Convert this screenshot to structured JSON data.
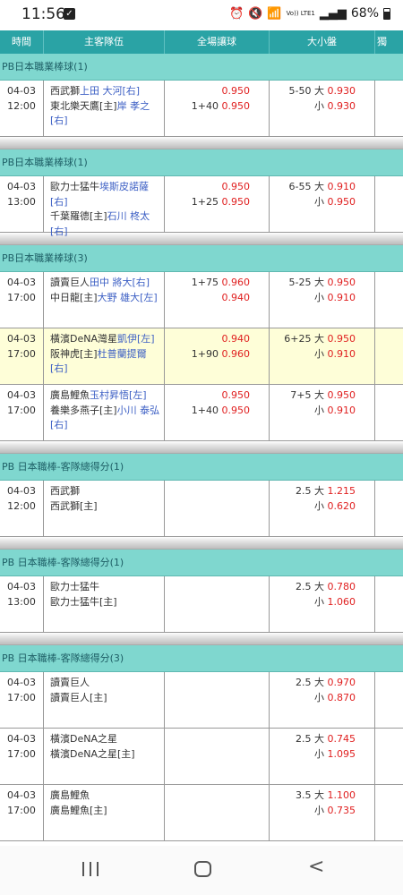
{
  "status_bar": {
    "time": "11:56",
    "battery": "68%",
    "volte": "Vo)) LTE1"
  },
  "header": {
    "time": "時間",
    "teams": "主客隊伍",
    "handicap": "全場讓球",
    "over_under": "大小盤",
    "extra": "獨"
  },
  "sections": [
    {
      "league": "PB日本職業棒球(1)",
      "matches": [
        {
          "date": "04-03",
          "time": "12:00",
          "highlight": false,
          "team1": "西武獅",
          "p1": "上田 大河[右]",
          "team2": "東北樂天鷹[主]",
          "p2": "岸 孝之[右]",
          "hdp_line1": "",
          "hdp_odds1": "0.950",
          "hdp_line2": "1+40",
          "hdp_odds2": "0.950",
          "ou_line1": "5-50 大",
          "ou_odds1": "0.930",
          "ou_line2": "小",
          "ou_odds2": "0.930"
        }
      ]
    },
    {
      "league": "PB日本職業棒球(1)",
      "matches": [
        {
          "date": "04-03",
          "time": "13:00",
          "highlight": false,
          "team1": "歐力士猛牛",
          "p1": "埃斯皮諾薩[右]",
          "team2": "千葉羅德[主]",
          "p2": "石川 柊太[右]",
          "hdp_line1": "",
          "hdp_odds1": "0.950",
          "hdp_line2": "1+25",
          "hdp_odds2": "0.950",
          "ou_line1": "6-55 大",
          "ou_odds1": "0.910",
          "ou_line2": "小",
          "ou_odds2": "0.950"
        }
      ]
    },
    {
      "league": "PB日本職業棒球(3)",
      "matches": [
        {
          "date": "04-03",
          "time": "17:00",
          "highlight": false,
          "team1": "讀賣巨人",
          "p1": "田中 將大[右]",
          "team2": "中日龍[主]",
          "p2": "大野 雄大[左]",
          "hdp_line1": "1+75",
          "hdp_odds1": "0.960",
          "hdp_line2": "",
          "hdp_odds2": "0.940",
          "ou_line1": "5-25 大",
          "ou_odds1": "0.950",
          "ou_line2": "小",
          "ou_odds2": "0.910"
        },
        {
          "date": "04-03",
          "time": "17:00",
          "highlight": true,
          "team1": "橫濱DeNA灣星",
          "p1": "凱伊[左]",
          "team2": "阪神虎[主]",
          "p2": "杜普蘭提爾[右]",
          "hdp_line1": "",
          "hdp_odds1": "0.940",
          "hdp_line2": "1+90",
          "hdp_odds2": "0.960",
          "ou_line1": "6+25 大",
          "ou_odds1": "0.950",
          "ou_line2": "小",
          "ou_odds2": "0.910"
        },
        {
          "date": "04-03",
          "time": "17:00",
          "highlight": false,
          "team1": "廣島鯉魚",
          "p1": "玉村昇悟[左]",
          "team2": "養樂多燕子[主]",
          "p2": "小川 泰弘[右]",
          "hdp_line1": "",
          "hdp_odds1": "0.950",
          "hdp_line2": "1+40",
          "hdp_odds2": "0.950",
          "ou_line1": "7+5 大",
          "ou_odds1": "0.950",
          "ou_line2": "小",
          "ou_odds2": "0.910"
        }
      ]
    },
    {
      "league": "PB 日本職棒-客隊總得分(1)",
      "matches": [
        {
          "date": "04-03",
          "time": "12:00",
          "highlight": false,
          "team1": "西武獅",
          "p1": "",
          "team2": "西武獅[主]",
          "p2": "",
          "hdp_line1": "",
          "hdp_odds1": "",
          "hdp_line2": "",
          "hdp_odds2": "",
          "ou_line1": "2.5 大",
          "ou_odds1": "1.215",
          "ou_line2": "小",
          "ou_odds2": "0.620"
        }
      ]
    },
    {
      "league": "PB 日本職棒-客隊總得分(1)",
      "matches": [
        {
          "date": "04-03",
          "time": "13:00",
          "highlight": false,
          "team1": "歐力士猛牛",
          "p1": "",
          "team2": "歐力士猛牛[主]",
          "p2": "",
          "hdp_line1": "",
          "hdp_odds1": "",
          "hdp_line2": "",
          "hdp_odds2": "",
          "ou_line1": "2.5 大",
          "ou_odds1": "0.780",
          "ou_line2": "小",
          "ou_odds2": "1.060"
        }
      ]
    },
    {
      "league": "PB 日本職棒-客隊總得分(3)",
      "matches": [
        {
          "date": "04-03",
          "time": "17:00",
          "highlight": false,
          "team1": "讀賣巨人",
          "p1": "",
          "team2": "讀賣巨人[主]",
          "p2": "",
          "hdp_line1": "",
          "hdp_odds1": "",
          "hdp_line2": "",
          "hdp_odds2": "",
          "ou_line1": "2.5 大",
          "ou_odds1": "0.970",
          "ou_line2": "小",
          "ou_odds2": "0.870"
        },
        {
          "date": "04-03",
          "time": "17:00",
          "highlight": false,
          "team1": "橫濱DeNA之星",
          "p1": "",
          "team2": "橫濱DeNA之星[主]",
          "p2": "",
          "hdp_line1": "",
          "hdp_odds1": "",
          "hdp_line2": "",
          "hdp_odds2": "",
          "ou_line1": "2.5 大",
          "ou_odds1": "0.745",
          "ou_line2": "小",
          "ou_odds2": "1.095"
        },
        {
          "date": "04-03",
          "time": "17:00",
          "highlight": false,
          "team1": "廣島鯉魚",
          "p1": "",
          "team2": "廣島鯉魚[主]",
          "p2": "",
          "hdp_line1": "",
          "hdp_odds1": "",
          "hdp_line2": "",
          "hdp_odds2": "",
          "ou_line1": "3.5 大",
          "ou_odds1": "1.100",
          "ou_line2": "小",
          "ou_odds2": "0.735"
        }
      ]
    }
  ],
  "colors": {
    "header": "#2aa3a5",
    "league_bar": "#7fd7cf",
    "odds": "#e02020",
    "pitcher": "#3c5fc4",
    "highlight_row": "#fefed8"
  },
  "icons": {
    "notification": "check-square-icon",
    "alarm": "alarm-icon",
    "mute": "mute-icon",
    "wifi": "wifi-icon",
    "signal": "signal-icon",
    "battery": "battery-icon"
  }
}
